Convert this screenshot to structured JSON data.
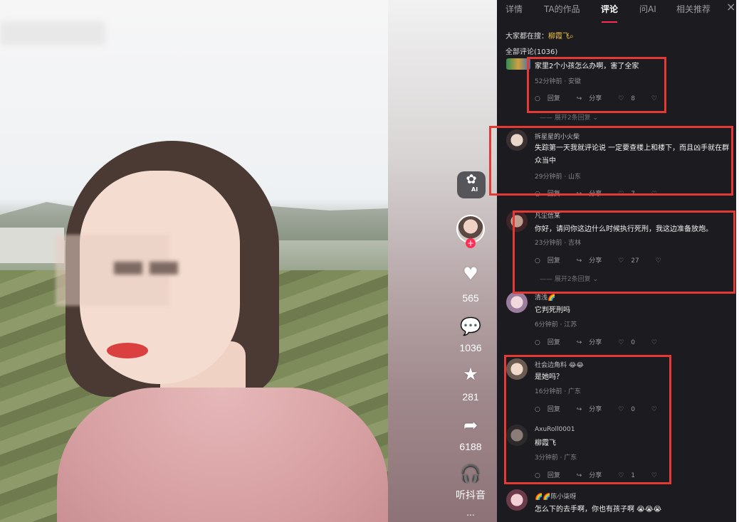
{
  "tabs": [
    "详情",
    "TA的作品",
    "评论",
    "问AI",
    "相关推荐"
  ],
  "close_icon": "×",
  "search_hint": {
    "label": "大家都在搜：",
    "keyword": "柳霞飞",
    "icon": "search-icon"
  },
  "comments_title": "全部评论(1036)",
  "rail": {
    "ai_label": "AI",
    "likes": "565",
    "comments": "1036",
    "favorites": "281",
    "shares": "6188",
    "listen_label": "听抖音",
    "more": "..."
  },
  "comments": [
    {
      "name": "",
      "text": "家里2个小孩怎么办啊，害了全家",
      "meta": "52分钟前 · 安徽",
      "reply": "回复",
      "share": "分享",
      "likes": "8",
      "expand": "展开2条回复"
    },
    {
      "name": "拆星星的小火柴",
      "text": "失踪第一天我就评论说 一定要查楼上和楼下，而且凶手就在群众当中",
      "meta": "29分钟前 · 山东",
      "reply": "回复",
      "share": "分享",
      "likes": "7"
    },
    {
      "name": "凡尘信某",
      "text": "你好，请问你这边什么时候执行死刑，我这边准备放炮。",
      "meta": "23分钟前 · 吉林",
      "reply": "回复",
      "share": "分享",
      "likes": "27",
      "expand": "展开2条回复"
    },
    {
      "name": "清浅🌈",
      "text": "它判死刑吗",
      "meta": "6分钟前 · 江苏",
      "reply": "回复",
      "share": "分享",
      "likes": "0"
    },
    {
      "name": "社会边角料 😂😂",
      "text": "是她吗？",
      "meta": "16分钟前 · 广东",
      "reply": "回复",
      "share": "分享",
      "likes": "0"
    },
    {
      "name": "AxuRoll0001",
      "text": "柳霞飞",
      "meta": "3分钟前 · 广东",
      "reply": "回复",
      "share": "分享",
      "likes": "1"
    },
    {
      "name": "🌈🌈陈小柒呀",
      "text": "怎么下的去手啊，你也有孩子啊 😭😭😭",
      "meta": ""
    }
  ],
  "colors": {
    "accent": "#ff2d55",
    "highlight_box": "#e53935",
    "keyword": "#f5c542"
  }
}
